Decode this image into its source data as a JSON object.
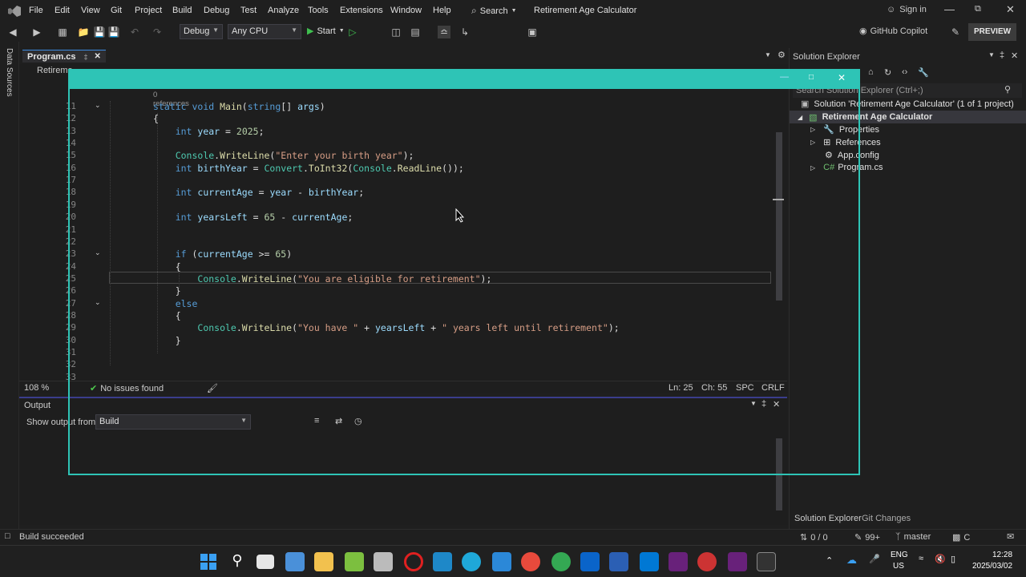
{
  "menu": {
    "items": [
      "File",
      "Edit",
      "View",
      "Git",
      "Project",
      "Build",
      "Debug",
      "Test",
      "Analyze",
      "Tools",
      "Extensions",
      "Window",
      "Help"
    ],
    "search_label": "Search",
    "window_title": "Retirement Age Calculator",
    "sign_in": "Sign in"
  },
  "toolbar": {
    "config": "Debug",
    "platform": "Any CPU",
    "start_label": "Start",
    "copilot": "GitHub Copilot",
    "preview": "PREVIEW"
  },
  "left_rail": {
    "label": "Data Sources"
  },
  "editor_tab": {
    "label": "Program.cs",
    "sub_label": "Retireme"
  },
  "editor": {
    "references": "0 references",
    "lines": [
      {
        "n": "11",
        "segs": [
          [
            "kw",
            "static "
          ],
          [
            "kw",
            "void "
          ],
          [
            "fn",
            "Main"
          ],
          [
            "p",
            "("
          ],
          [
            "kw",
            "string"
          ],
          [
            "p",
            "[] "
          ],
          [
            "var",
            "args"
          ],
          [
            "p",
            ")"
          ]
        ]
      },
      {
        "n": "12",
        "segs": [
          [
            "p",
            "{"
          ]
        ]
      },
      {
        "n": "13",
        "segs": [
          [
            "p",
            "    "
          ],
          [
            "kw",
            "int "
          ],
          [
            "var",
            "year"
          ],
          [
            "p",
            " = "
          ],
          [
            "num",
            "2025"
          ],
          [
            "p",
            ";"
          ]
        ]
      },
      {
        "n": "14",
        "segs": []
      },
      {
        "n": "15",
        "segs": [
          [
            "p",
            "    "
          ],
          [
            "ty",
            "Console"
          ],
          [
            "p",
            "."
          ],
          [
            "fn",
            "WriteLine"
          ],
          [
            "p",
            "("
          ],
          [
            "str",
            "\"Enter your birth year\""
          ],
          [
            "p",
            ");"
          ]
        ]
      },
      {
        "n": "16",
        "segs": [
          [
            "p",
            "    "
          ],
          [
            "kw",
            "int "
          ],
          [
            "var",
            "birthYear"
          ],
          [
            "p",
            " = "
          ],
          [
            "ty",
            "Convert"
          ],
          [
            "p",
            "."
          ],
          [
            "fn",
            "ToInt32"
          ],
          [
            "p",
            "("
          ],
          [
            "ty",
            "Console"
          ],
          [
            "p",
            "."
          ],
          [
            "fn",
            "ReadLine"
          ],
          [
            "p",
            "());"
          ]
        ]
      },
      {
        "n": "17",
        "segs": []
      },
      {
        "n": "18",
        "segs": [
          [
            "p",
            "    "
          ],
          [
            "kw",
            "int "
          ],
          [
            "var",
            "currentAge"
          ],
          [
            "p",
            " = "
          ],
          [
            "var",
            "year"
          ],
          [
            "p",
            " - "
          ],
          [
            "var",
            "birthYear"
          ],
          [
            "p",
            ";"
          ]
        ]
      },
      {
        "n": "19",
        "segs": []
      },
      {
        "n": "20",
        "segs": [
          [
            "p",
            "    "
          ],
          [
            "kw",
            "int "
          ],
          [
            "var",
            "yearsLeft"
          ],
          [
            "p",
            " = "
          ],
          [
            "num",
            "65"
          ],
          [
            "p",
            " - "
          ],
          [
            "var",
            "currentAge"
          ],
          [
            "p",
            ";"
          ]
        ]
      },
      {
        "n": "21",
        "segs": []
      },
      {
        "n": "22",
        "segs": []
      },
      {
        "n": "23",
        "segs": [
          [
            "p",
            "    "
          ],
          [
            "kw",
            "if "
          ],
          [
            "p",
            "("
          ],
          [
            "var",
            "currentAge"
          ],
          [
            "p",
            " >= "
          ],
          [
            "num",
            "65"
          ],
          [
            "p",
            ")"
          ]
        ]
      },
      {
        "n": "24",
        "segs": [
          [
            "p",
            "    {"
          ]
        ]
      },
      {
        "n": "25",
        "segs": [
          [
            "p",
            "        "
          ],
          [
            "ty",
            "Console"
          ],
          [
            "p",
            "."
          ],
          [
            "fn",
            "WriteLine"
          ],
          [
            "p",
            "("
          ],
          [
            "str",
            "\"You are eligible for retirement\""
          ],
          [
            "p",
            ");"
          ]
        ]
      },
      {
        "n": "26",
        "segs": [
          [
            "p",
            "    }"
          ]
        ]
      },
      {
        "n": "27",
        "segs": [
          [
            "p",
            "    "
          ],
          [
            "kw",
            "else"
          ]
        ]
      },
      {
        "n": "28",
        "segs": [
          [
            "p",
            "    {"
          ]
        ]
      },
      {
        "n": "29",
        "segs": [
          [
            "p",
            "        "
          ],
          [
            "ty",
            "Console"
          ],
          [
            "p",
            "."
          ],
          [
            "fn",
            "WriteLine"
          ],
          [
            "p",
            "("
          ],
          [
            "str",
            "\"You have \""
          ],
          [
            "p",
            " + "
          ],
          [
            "var",
            "yearsLeft"
          ],
          [
            "p",
            " + "
          ],
          [
            "str",
            "\" years left until retirement\""
          ],
          [
            "p",
            ");"
          ]
        ]
      },
      {
        "n": "30",
        "segs": [
          [
            "p",
            "    }"
          ]
        ]
      },
      {
        "n": "31",
        "segs": []
      },
      {
        "n": "32",
        "segs": []
      },
      {
        "n": "33",
        "segs": []
      }
    ]
  },
  "editor_status": {
    "zoom": "108 %",
    "issues": "No issues found",
    "ln": "Ln: 25",
    "ch": "Ch: 55",
    "spc": "SPC",
    "crlf": "CRLF"
  },
  "output": {
    "title": "Output",
    "show_from_label": "Show output from:",
    "source": "Build"
  },
  "solution_explorer": {
    "title": "Solution Explorer",
    "search_placeholder": "Search Solution Explorer (Ctrl+;)",
    "solution": "Solution 'Retirement Age Calculator' (1 of 1 project)",
    "project": "Retirement Age Calculator",
    "items": [
      "Properties",
      "References",
      "App.config",
      "Program.cs"
    ],
    "tabs": [
      "Solution Explorer",
      "Git Changes"
    ]
  },
  "statusbar": {
    "message": "Build succeeded",
    "errors": "0 / 0",
    "count": "99+",
    "branch": "master",
    "repo": "C"
  },
  "taskbar": {
    "lang": "ENG",
    "region": "US",
    "time": "12:28",
    "date": "2025/03/02"
  },
  "colors": {
    "accent_teal": "#2ec4b6",
    "vs_purple": "#68217a"
  }
}
